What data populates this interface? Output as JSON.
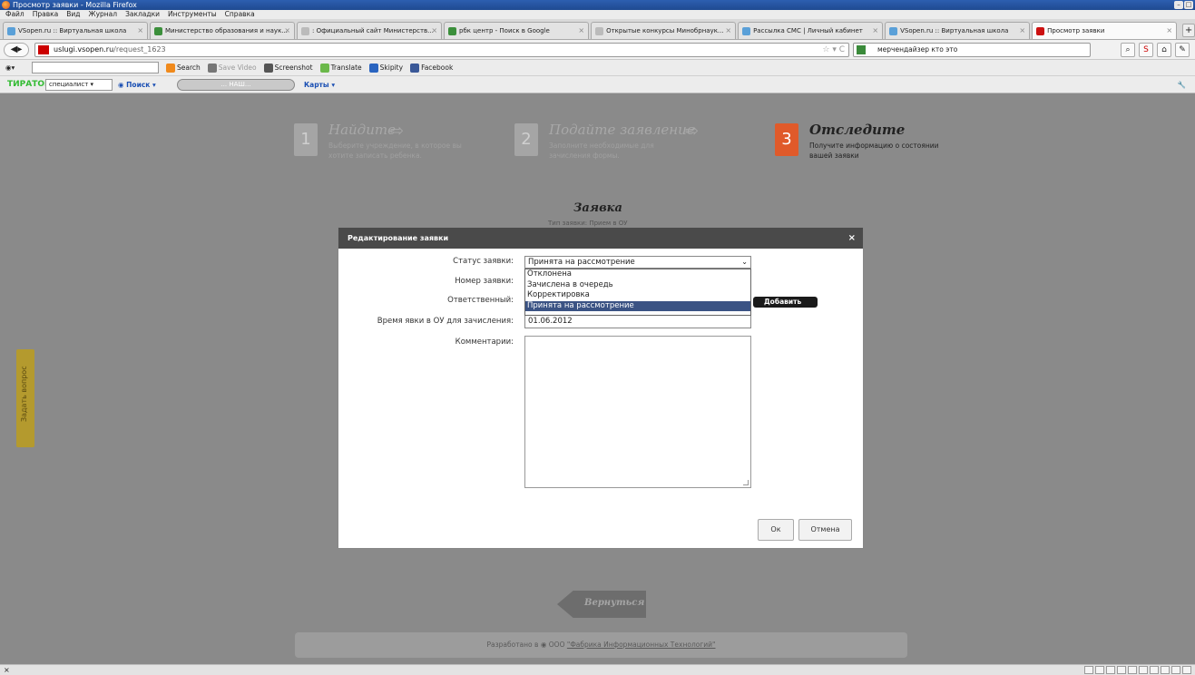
{
  "window": {
    "title": "Просмотр заявки - Mozilla Firefox",
    "min": "–",
    "max": "□"
  },
  "menu": [
    "Файл",
    "Правка",
    "Вид",
    "Журнал",
    "Закладки",
    "Инструменты",
    "Справка"
  ],
  "tabs": [
    {
      "label": "VSopen.ru :: Виртуальная школа",
      "color": "#5aa0d8"
    },
    {
      "label": "Министерство образования и наук...",
      "color": "#3b8f3b"
    },
    {
      "label": ": Официальный сайт Министерств...",
      "color": "#bbbbbb"
    },
    {
      "label": "рбк центр - Поиск в Google",
      "color": "#3b8f3b"
    },
    {
      "label": "Открытые конкурсы Минобрнаук...",
      "color": "#bbbbbb"
    },
    {
      "label": "Рассылка СМС | Личный кабинет",
      "color": "#5aa0d8"
    },
    {
      "label": "VSopen.ru :: Виртуальная школа",
      "color": "#5aa0d8"
    },
    {
      "label": "Просмотр заявки",
      "color": "#cc1111",
      "active": true
    }
  ],
  "nav": {
    "url_host": "uslugi.vsopen.ru",
    "url_path": "/request_1623",
    "search_text": "мерчендайзер кто это"
  },
  "bookmarks": [
    "Search",
    "Save Video",
    "Screenshot",
    "Translate",
    "Skipity",
    "Facebook"
  ],
  "toolbar2": {
    "logo": "ТИРАТОР",
    "select_value": "специалист",
    "poisk": "Поиск",
    "pill": "... НАШ...",
    "karty": "Карты"
  },
  "steps": [
    {
      "num": "1",
      "title": "Найдите",
      "desc": "Выберите учреждение, в которое вы хотите записать ребенка."
    },
    {
      "num": "2",
      "title": "Подайте заявление",
      "desc": "Заполните необходимые для зачисления формы."
    },
    {
      "num": "3",
      "title": "Отследите",
      "desc": "Получите информацию о состоянии вашей заявки"
    }
  ],
  "page": {
    "heading": "Заявка",
    "subheading": "Тип заявки: Прием в ОУ",
    "side_tab": "Задать вопрос",
    "back": "Вернуться"
  },
  "footer": {
    "prefix": "Разработано в ",
    "company": "ООО ",
    "link": "\"Фабрика Информационных Технологий\""
  },
  "modal": {
    "title": "Редактирование заявки",
    "close": "×",
    "labels": {
      "status": "Статус заявки:",
      "number": "Номер заявки:",
      "responsible": "Ответственный:",
      "time": "Время явки в ОУ для зачисления:",
      "comments": "Комментарии:"
    },
    "status_value": "Принята на рассмотрение",
    "status_options": [
      "Отклонена",
      "Зачислена в очередь",
      "Корректировка",
      "Принята на рассмотрение"
    ],
    "add_button": "Добавить",
    "date_value": "01.06.2012",
    "ok": "Ок",
    "cancel": "Отмена"
  },
  "statusbar": {
    "close": "×"
  }
}
